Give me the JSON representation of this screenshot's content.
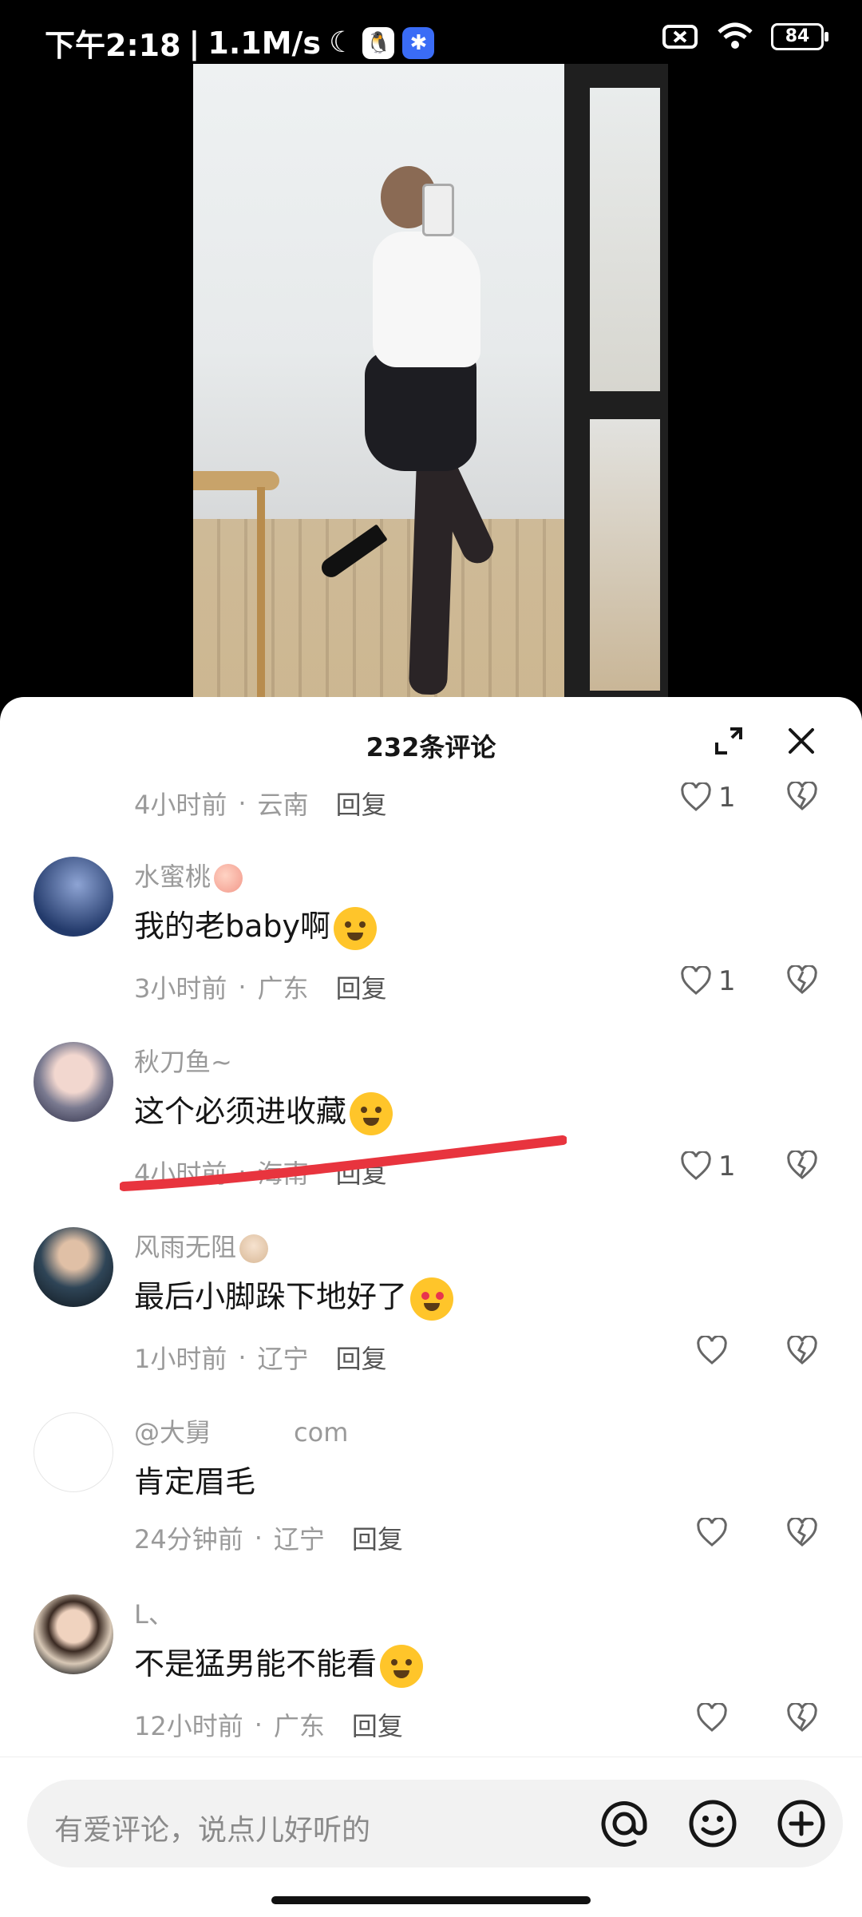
{
  "statusbar": {
    "time": "下午2:18",
    "speed": "1.1M/s",
    "battery": "84"
  },
  "sheet": {
    "title": "232条评论"
  },
  "comments": [
    {
      "username": "",
      "text": "",
      "time": "4小时前",
      "location": "云南",
      "reply": "回复",
      "likes": "1",
      "avatar_color": "#ffffff"
    },
    {
      "username": "水蜜桃",
      "text": "我的老baby啊",
      "time": "3小时前",
      "location": "广东",
      "reply": "回复",
      "likes": "1",
      "avatar_color": "#233a6b"
    },
    {
      "username": "秋刀鱼~",
      "text": "这个必须进收藏",
      "time": "4小时前",
      "location": "海南",
      "reply": "回复",
      "likes": "1",
      "avatar_color": "#4b4b63"
    },
    {
      "username": "风雨无阻",
      "text": "最后小脚跺下地好了",
      "time": "1小时前",
      "location": "辽宁",
      "reply": "回复",
      "likes": "",
      "avatar_color": "#2f4557"
    },
    {
      "username": "@大舅",
      "username_suffix": "com",
      "text": "肯定眉毛",
      "time": "24分钟前",
      "location": "辽宁",
      "reply": "回复",
      "likes": "",
      "avatar_color": "#ffffff"
    },
    {
      "username": "L、",
      "text": "不是猛男能不能看",
      "time": "12小时前",
      "location": "广东",
      "reply": "回复",
      "likes": "",
      "avatar_color": "#d8c8b6"
    }
  ],
  "input": {
    "placeholder": "有爱评论，说点儿好听的"
  },
  "colors": {
    "annotation_red": "#e8343e",
    "text_primary": "#161616",
    "text_secondary": "#9a9a9a"
  }
}
